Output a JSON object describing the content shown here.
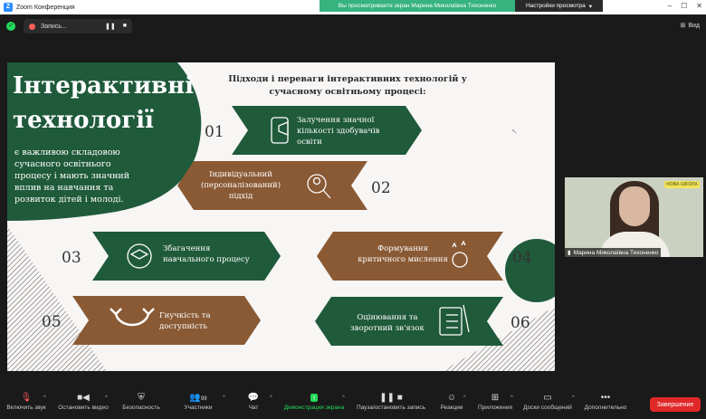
{
  "window": {
    "app_title": "Zoom Конференция"
  },
  "banner": {
    "sharing_text": "Вы просматриваете экран Марина Миколаївна Тихоненко",
    "view_options": "Настройки просмотра"
  },
  "recording": {
    "label": "Запись..."
  },
  "view_button": "Вид",
  "slide": {
    "title_line1": "Інтерактивні",
    "title_line2": "технології",
    "description": [
      "є важливою складовою",
      "сучасного освітнього",
      "процесу і мають значний",
      "вплив на навчання та",
      "розвиток дітей і молоді."
    ],
    "subtitle_line1": "Підходи і переваги інтерактивних технологій у",
    "subtitle_line2": "сучасному освітньому процесі:",
    "items": [
      {
        "num": "01",
        "lines": [
          "Залучення значної",
          "кількості здобувачів",
          "освіти"
        ]
      },
      {
        "num": "02",
        "lines": [
          "Індивідуальний",
          "(персоналізований)",
          "підхід"
        ]
      },
      {
        "num": "03",
        "lines": [
          "Збагачення",
          "навчального процесу"
        ]
      },
      {
        "num": "04",
        "lines": [
          "Формування",
          "критичного мислення"
        ]
      },
      {
        "num": "05",
        "lines": [
          "Гнучкість та",
          "доступність"
        ]
      },
      {
        "num": "06",
        "lines": [
          "Оцінювання та",
          "зворотний зв'язок"
        ]
      }
    ],
    "colors": {
      "green": "#1f5a3b",
      "brown": "#8a5a35",
      "bg": "#f8f6f5"
    }
  },
  "participant": {
    "name": "Марина Миколаївна Тихоненко",
    "logo": "НОВА ШКОЛА"
  },
  "toolbar": {
    "unmute": "Включить звук",
    "stop_video": "Остановить видео",
    "security": "Безопасность",
    "participants": "Участники",
    "participants_count": "99",
    "chat": "Чат",
    "share_screen": "Демонстрация экрана",
    "pause_recording": "Пауза/остановить запись",
    "reactions": "Реакции",
    "apps": "Приложения",
    "whiteboards": "Доски сообщений",
    "more": "Дополнительно",
    "end": "Завершение"
  }
}
